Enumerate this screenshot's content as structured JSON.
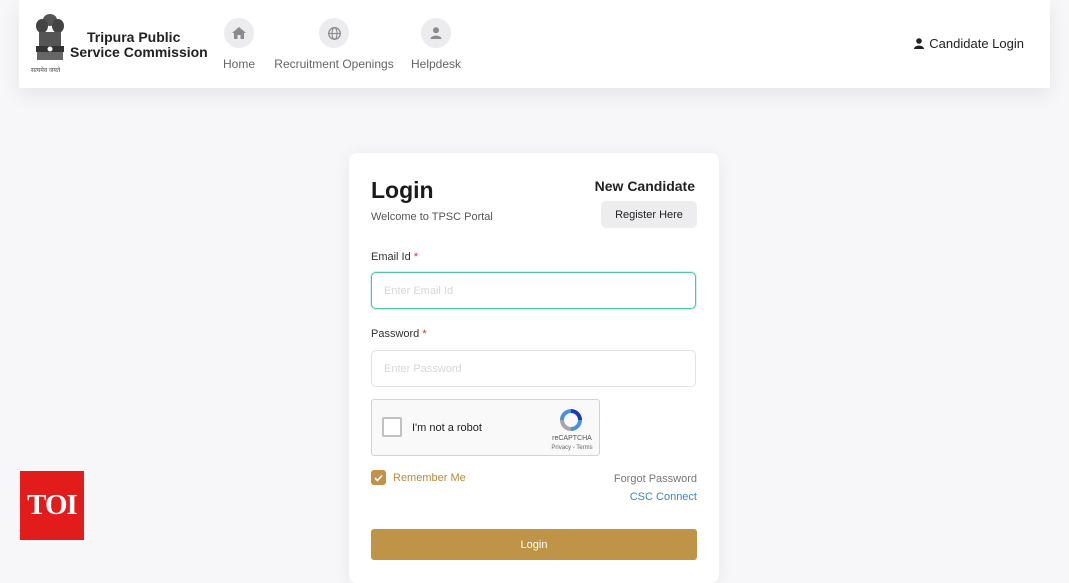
{
  "header": {
    "brand_line1": "Tripura Public",
    "brand_line2": "Service Commission",
    "emblem_motto": "सत्यमेव जयते",
    "nav": [
      {
        "label": "Home",
        "icon": "home-icon"
      },
      {
        "label": "Recruitment Openings",
        "icon": "globe-icon"
      },
      {
        "label": "Helpdesk",
        "icon": "user-icon"
      }
    ],
    "candidate_login_label": "Candidate Login",
    "candidate_login_icon": "user-icon"
  },
  "login_card": {
    "title": "Login",
    "subtitle": "Welcome to TPSC Portal",
    "new_candidate_label": "New Candidate",
    "register_button_label": "Register Here",
    "email_label": "Email Id",
    "email_placeholder": "Enter Email Id",
    "password_label": "Password",
    "password_placeholder": "Enter Password",
    "required_mark": "*",
    "captcha": {
      "label": "I'm not a robot",
      "brand": "reCAPTCHA",
      "terms": "Privacy - Terms"
    },
    "remember_me_label": "Remember Me",
    "remember_me_checked": true,
    "forgot_password_label": "Forgot Password",
    "csc_connect_label": "CSC Connect",
    "login_button_label": "Login"
  },
  "badge": {
    "text": "TOI"
  },
  "colors": {
    "accent_gold": "#bf9447",
    "focus_teal": "#4cc6a7",
    "link_blue": "#3b86c6",
    "required_red": "#d0312d",
    "badge_red": "#e21b1b"
  }
}
